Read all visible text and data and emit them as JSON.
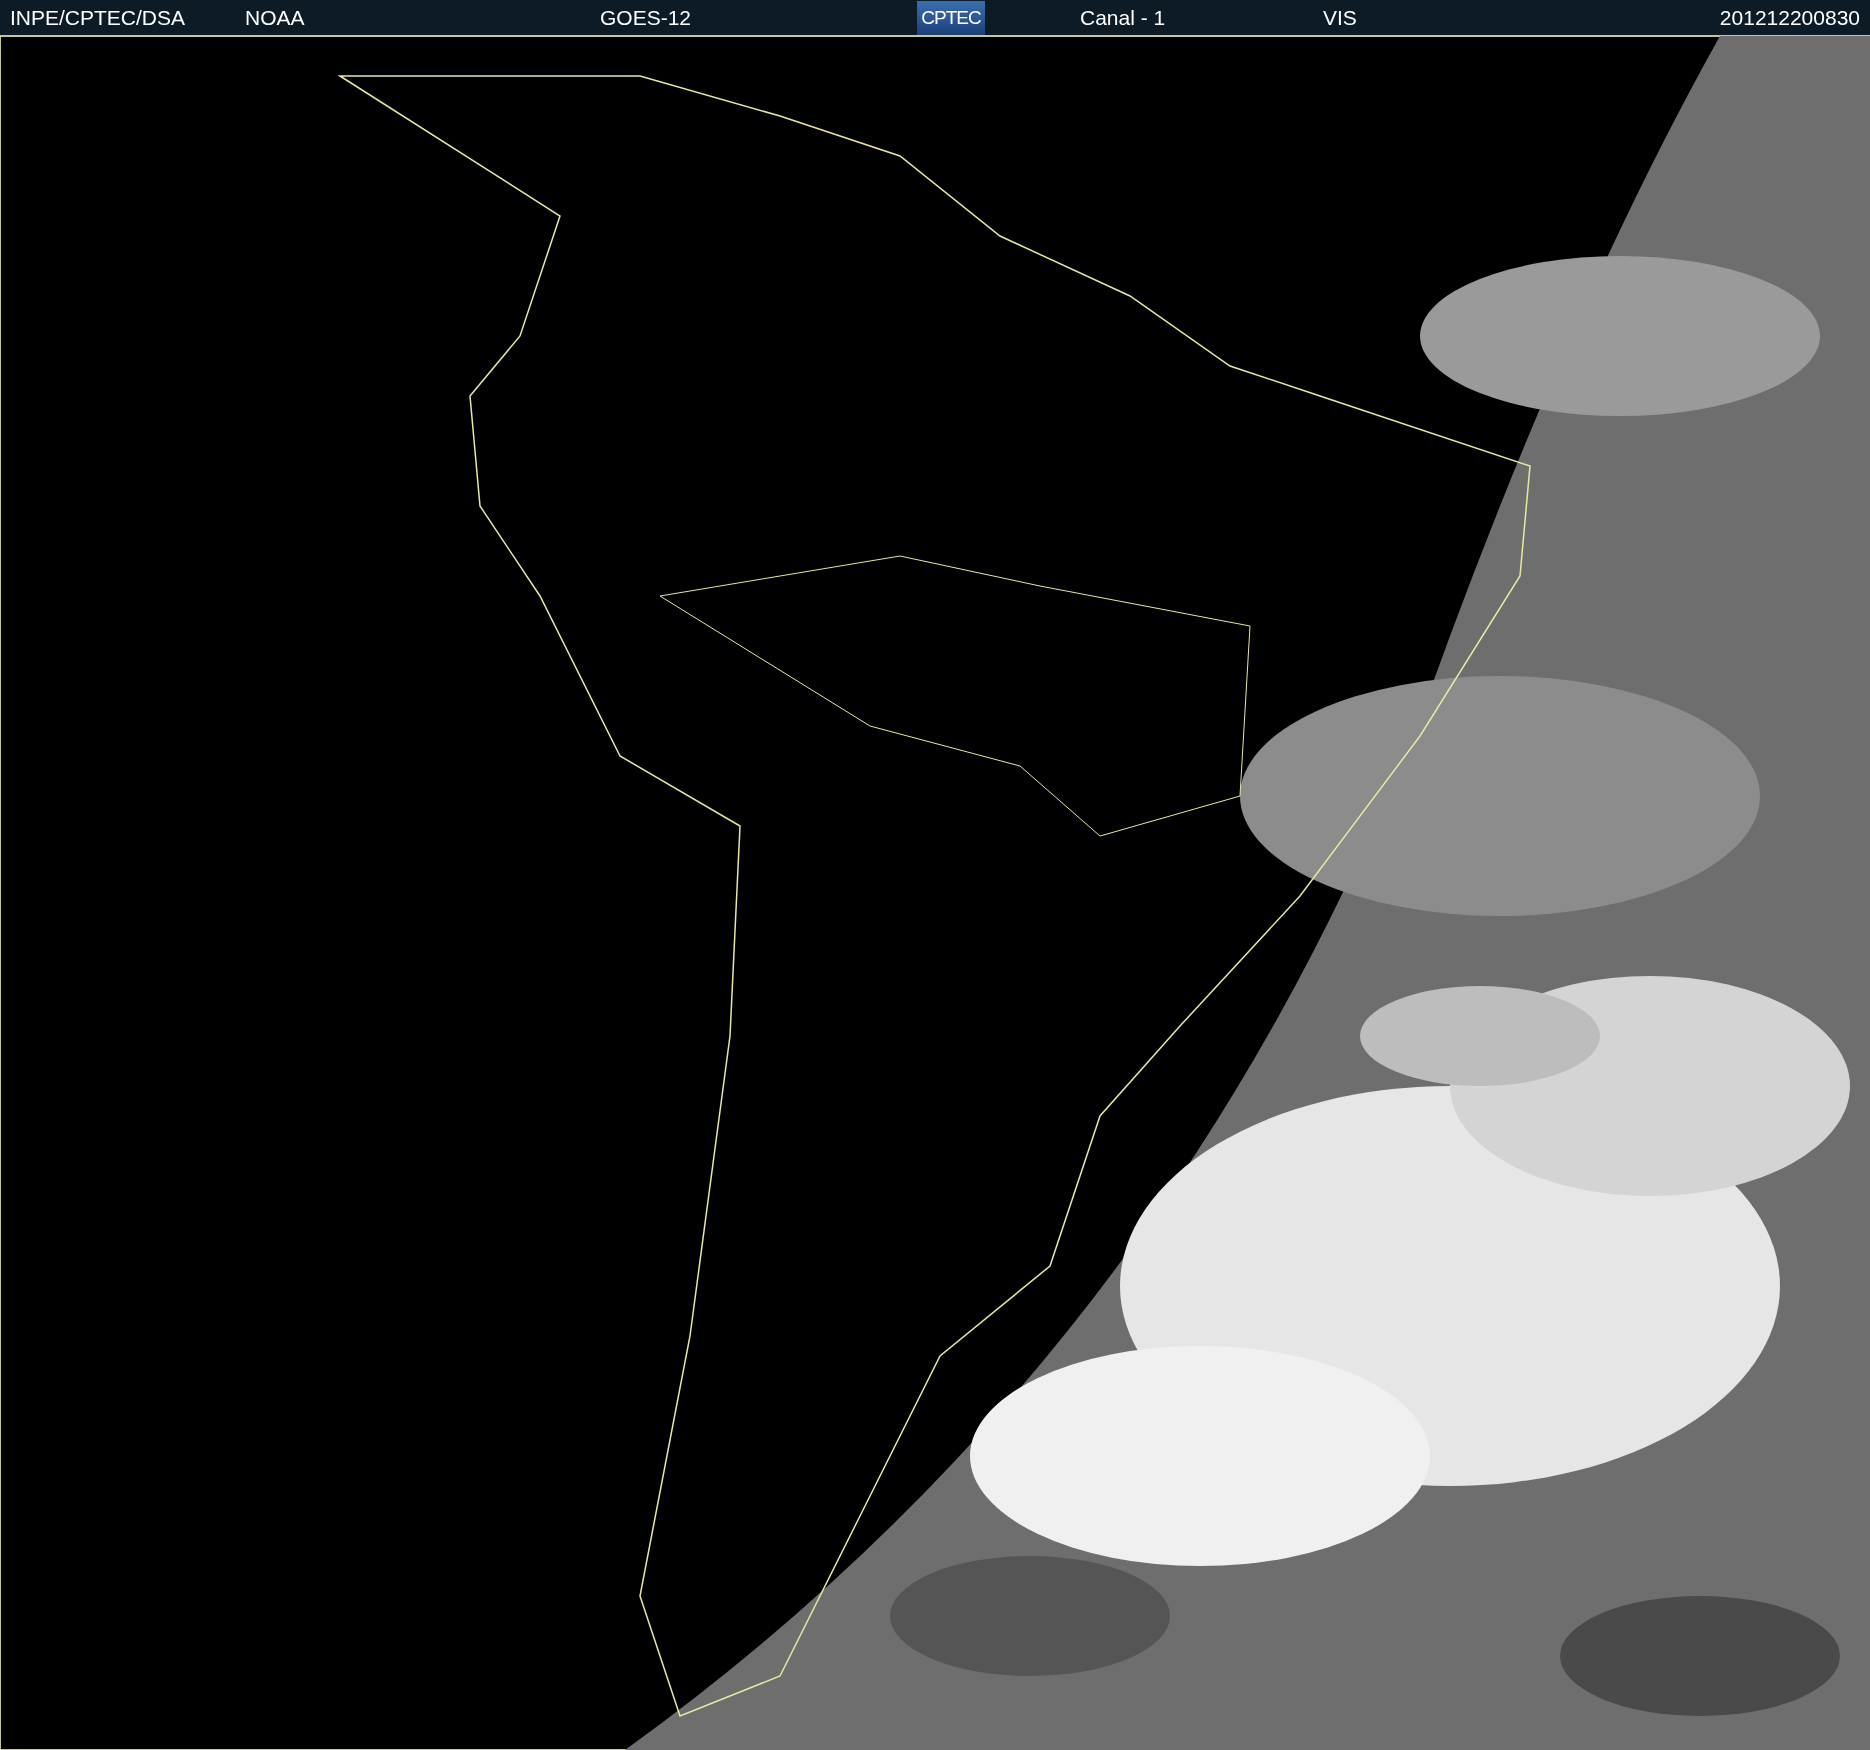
{
  "header": {
    "source": "INPE/CPTEC/DSA",
    "agency": "NOAA",
    "satellite": "GOES-12",
    "logo": "CPTEC",
    "channel": "Canal - 1",
    "band": "VIS",
    "timestamp": "201212200830"
  }
}
